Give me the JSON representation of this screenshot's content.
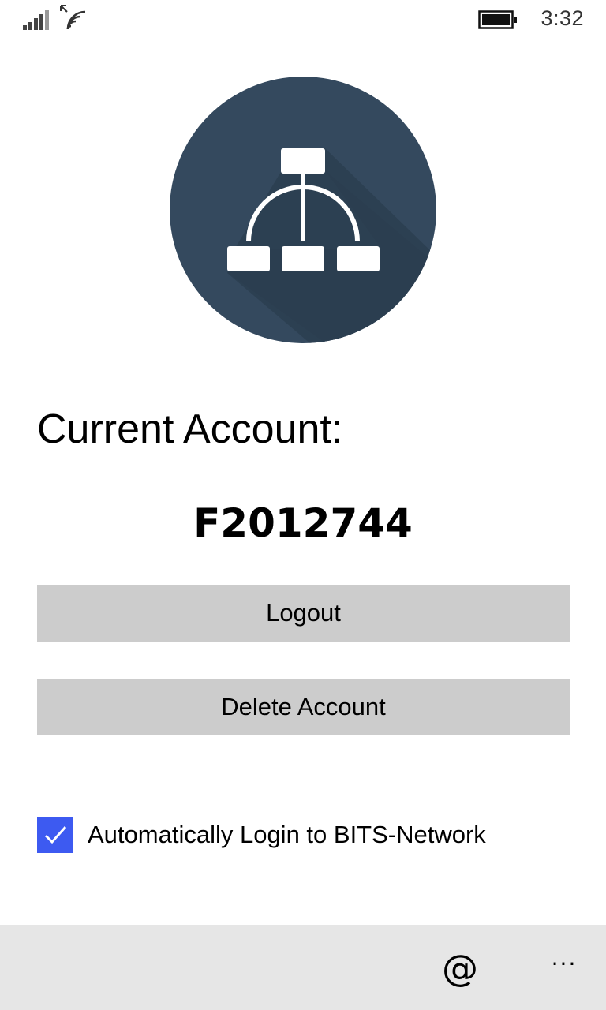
{
  "status_bar": {
    "time": "3:32",
    "icons": [
      "signal-icon",
      "wifi-icon",
      "battery-icon"
    ]
  },
  "logo": {
    "icon": "network-hierarchy-icon",
    "background_color": "#34495e",
    "shadow_color": "#2c3e50"
  },
  "account": {
    "heading": "Current Account:",
    "id": "F2012744"
  },
  "buttons": {
    "logout_label": "Logout",
    "delete_label": "Delete Account"
  },
  "auto_login": {
    "label": "Automatically Login to BITS-Network",
    "checked": true,
    "accent_color": "#3d5af1"
  },
  "app_bar": {
    "at_label": "@",
    "more_label": "···"
  }
}
